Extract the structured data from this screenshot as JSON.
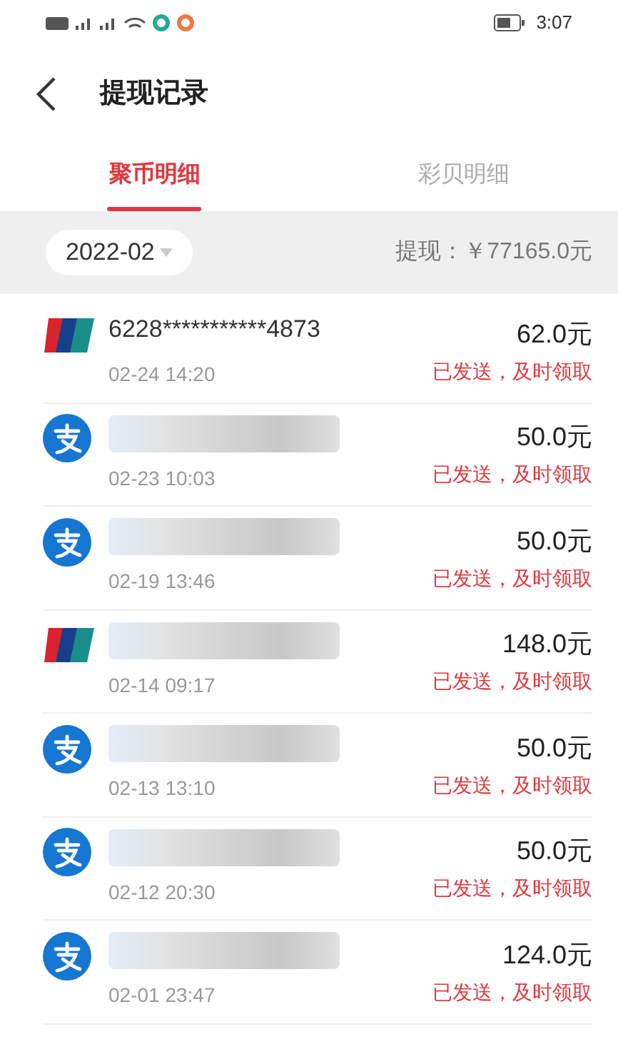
{
  "status_bar": {
    "time": "3:07"
  },
  "header": {
    "title": "提现记录"
  },
  "tabs": [
    {
      "label": "聚币明细",
      "selected": true
    },
    {
      "label": "彩贝明细",
      "selected": false
    }
  ],
  "filter": {
    "month": "2022-02",
    "total": "提现：￥77165.0元"
  },
  "records": [
    {
      "kind": "unionpay",
      "account": "6228***********4873",
      "redacted": false,
      "time": "02-24 14:20",
      "amount": "62.0元",
      "status": "已发送，及时领取"
    },
    {
      "kind": "alipay",
      "redacted": true,
      "time": "02-23 10:03",
      "amount": "50.0元",
      "status": "已发送，及时领取"
    },
    {
      "kind": "alipay",
      "redacted": true,
      "time": "02-19 13:46",
      "amount": "50.0元",
      "status": "已发送，及时领取"
    },
    {
      "kind": "unionpay",
      "redacted": true,
      "time": "02-14 09:17",
      "amount": "148.0元",
      "status": "已发送，及时领取"
    },
    {
      "kind": "alipay",
      "redacted": true,
      "time": "02-13 13:10",
      "amount": "50.0元",
      "status": "已发送，及时领取"
    },
    {
      "kind": "alipay",
      "redacted": true,
      "time": "02-12 20:30",
      "amount": "50.0元",
      "status": "已发送，及时领取"
    },
    {
      "kind": "alipay",
      "redacted": true,
      "time": "02-01 23:47",
      "amount": "124.0元",
      "status": "已发送，及时领取"
    }
  ]
}
